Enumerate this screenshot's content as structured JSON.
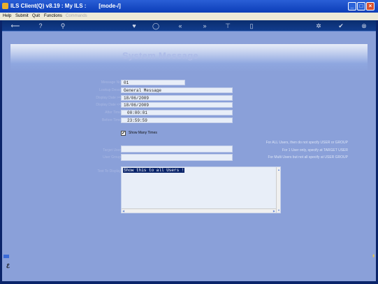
{
  "window": {
    "title": "ILS Client(Q) v8.19 : My ILS :        [mode-/]"
  },
  "menu": [
    "Help",
    "Submit",
    "Quit",
    "Functions",
    "Commands"
  ],
  "page": {
    "title": "System Message"
  },
  "form": {
    "fields": [
      {
        "label": "Message No",
        "value": "01"
      },
      {
        "label": "Lookup Descr",
        "value": "General Message"
      },
      {
        "label": "Display Date >=",
        "value": "18/06/2009"
      },
      {
        "label": "Display Date <=",
        "value": "18/06/2009"
      },
      {
        "label": "After Time",
        "value": "00:00:01"
      },
      {
        "label": "Before Time",
        "value": "23:59:59"
      }
    ],
    "show_many_times": {
      "label": "Show Many Times",
      "checked": true,
      "mark": "✔"
    },
    "target_user": {
      "label": "Target User",
      "value": ""
    },
    "user_group": {
      "label": "User Group",
      "value": ""
    },
    "text_to_display": {
      "label": "Text To Display",
      "value": "Show this to all Users !"
    }
  },
  "hints": [
    "For ALL Users, then do not specify USER or GROUP",
    "For 1 User only, specify at TARGET USER",
    "For Multi Users but not all specify at USER GROUP"
  ]
}
